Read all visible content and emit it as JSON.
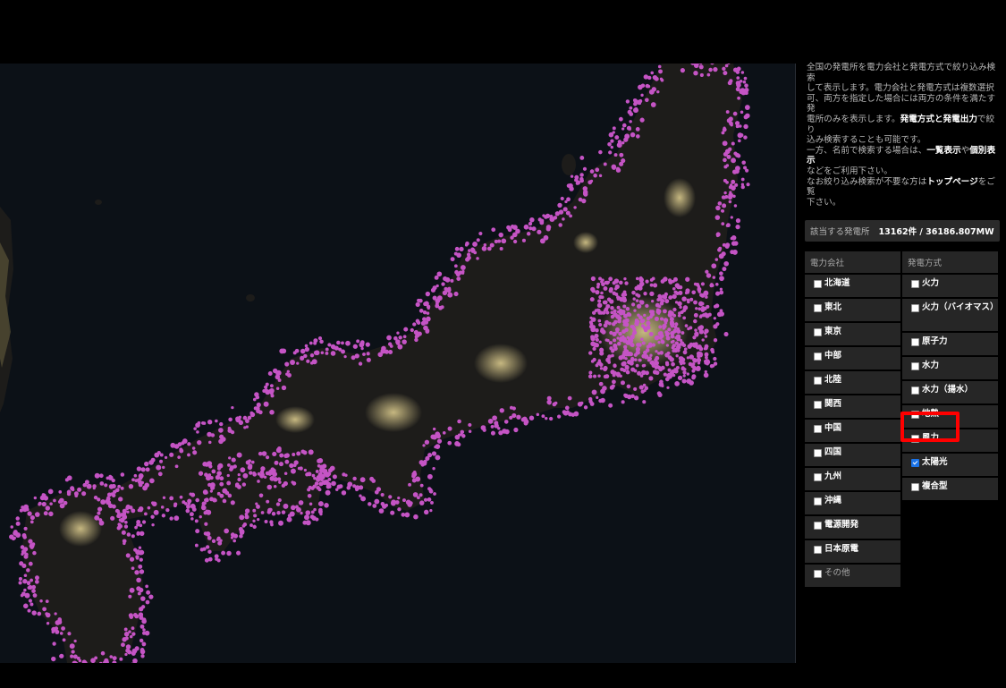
{
  "intro": {
    "l1": "全国の発電所を電力会社と発電方式で絞り込み検索",
    "l2": "して表示します。電力会社と発電方式は複数選択",
    "l3": "可、両方を指定した場合には両方の条件を満たす発",
    "l4a": "電所のみを表示します。",
    "l4b": "発電方式と発電出力",
    "l4c": "で絞り",
    "l5": "込み検索することも可能です。",
    "l6a": "一方、名前で検索する場合は、",
    "l6b": "一覧表示",
    "l6c": "や",
    "l6d": "個別表示",
    "l7": "などをご利用下さい。",
    "l8a": "なお絞り込み検索が不要な方は",
    "l8b": "トップページ",
    "l8c": "をご覧",
    "l9": "下さい。"
  },
  "result": {
    "label": "該当する発電所",
    "value": "13162件 / 36186.807MW"
  },
  "companies": {
    "header": "電力会社",
    "items": [
      "北海道",
      "東北",
      "東京",
      "中部",
      "北陸",
      "関西",
      "中国",
      "四国",
      "九州",
      "沖縄",
      "電源開発",
      "日本原電",
      "その他"
    ]
  },
  "methods": {
    "header": "発電方式",
    "items": [
      "火力",
      "火力（バイオマス）",
      "原子力",
      "水力",
      "水力（揚水）",
      "地熱",
      "風力",
      "太陽光",
      "複合型"
    ],
    "checked": "太陽光"
  },
  "colors": {
    "plant_dots": "#c554c5",
    "city_lights": "#cdbf8a",
    "land": "#1d1c1a",
    "sea": "#0c1117",
    "highlight": "#ff0000"
  }
}
